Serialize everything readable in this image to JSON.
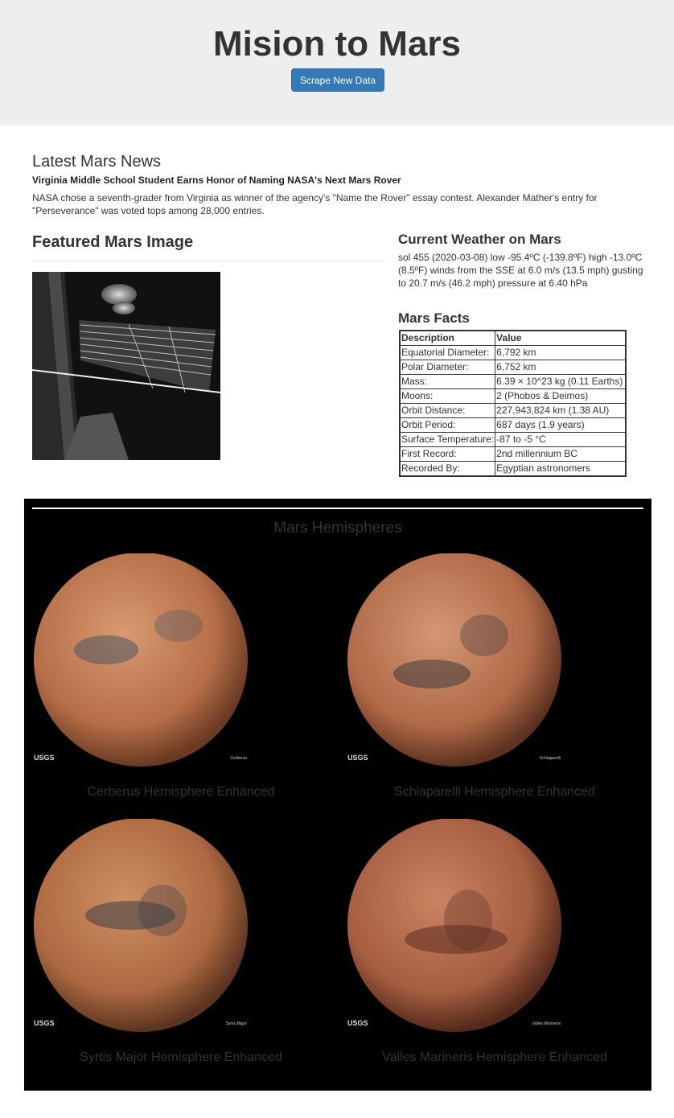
{
  "header": {
    "title": "Mision to Mars",
    "button_label": "Scrape New Data"
  },
  "news": {
    "heading": "Latest Mars News",
    "title": "Virginia Middle School Student Earns Honor of Naming NASA's Next Mars Rover",
    "paragraph": "NASA chose a seventh-grader from Virginia as winner of the agency's \"Name the Rover\" essay contest. Alexander Mather's entry for \"Perseverance\" was voted tops among 28,000 entries."
  },
  "featured": {
    "heading": "Featured Mars Image"
  },
  "weather": {
    "heading": "Current Weather on Mars",
    "text": "sol 455 (2020-03-08) low -95.4ºC (-139.8ºF) high -13.0ºC (8.5ºF) winds from the SSE at 6.0 m/s (13.5 mph) gusting to 20.7 m/s (46.2 mph) pressure at 6.40 hPa"
  },
  "facts": {
    "heading": "Mars Facts",
    "columns": [
      "Description",
      "Value"
    ],
    "rows": [
      [
        "Equatorial Diameter:",
        "6,792 km"
      ],
      [
        "Polar Diameter:",
        "6,752 km"
      ],
      [
        "Mass:",
        "6.39 × 10^23 kg (0.11 Earths)"
      ],
      [
        "Moons:",
        "2 (Phobos & Deimos)"
      ],
      [
        "Orbit Distance:",
        "227,943,824 km (1.38 AU)"
      ],
      [
        "Orbit Period:",
        "687 days (1.9 years)"
      ],
      [
        "Surface Temperature:",
        "-87 to -5 °C"
      ],
      [
        "First Record:",
        "2nd millennium BC"
      ],
      [
        "Recorded By:",
        "Egyptian astronomers"
      ]
    ]
  },
  "hemispheres": {
    "heading": "Mars Hemispheres",
    "items": [
      {
        "caption": "Cerberus Hemisphere Enhanced",
        "logo": "USGS",
        "label": "Cerberus",
        "colors": [
          "#d89a72",
          "#b56e48",
          "#6a3a22"
        ],
        "dark": "#4e5560"
      },
      {
        "caption": "Schiaparelli Hemisphere Enhanced",
        "logo": "USGS",
        "label": "Schiaparelli",
        "colors": [
          "#d49774",
          "#b06a48",
          "#5e3220"
        ],
        "dark": "#3e3a3c"
      },
      {
        "caption": "Syrtis Major Hemisphere Enhanced",
        "logo": "USGS",
        "label": "Syrtis Major",
        "colors": [
          "#cf8e62",
          "#ad6a42",
          "#5c3420"
        ],
        "dark": "#3d4048"
      },
      {
        "caption": "Valles Marineris Hemisphere Enhanced",
        "logo": "USGS",
        "label": "Valles Marineris",
        "colors": [
          "#c98462",
          "#a55e40",
          "#55291c"
        ],
        "dark": "#5b2e22"
      }
    ]
  }
}
